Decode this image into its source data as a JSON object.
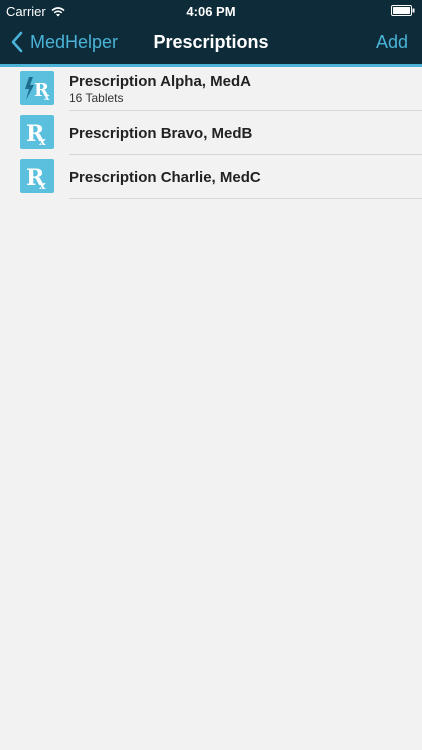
{
  "status_bar": {
    "carrier": "Carrier",
    "time": "4:06 PM",
    "wifi_icon": "wifi-icon",
    "battery_icon": "battery-icon"
  },
  "nav": {
    "back_label": "MedHelper",
    "title": "Prescriptions",
    "add_label": "Add"
  },
  "colors": {
    "bar_background": "#0d2b38",
    "accent": "#4bb3d8",
    "icon_background": "#5ac0de",
    "page_background": "#f2f2f2"
  },
  "prescriptions": [
    {
      "title": "Prescription Alpha, MedA",
      "subtitle": "16 Tablets",
      "icon": "rx-lightning-icon"
    },
    {
      "title": "Prescription Bravo, MedB",
      "subtitle": "",
      "icon": "rx-icon"
    },
    {
      "title": "Prescription Charlie, MedC",
      "subtitle": "",
      "icon": "rx-icon"
    }
  ]
}
